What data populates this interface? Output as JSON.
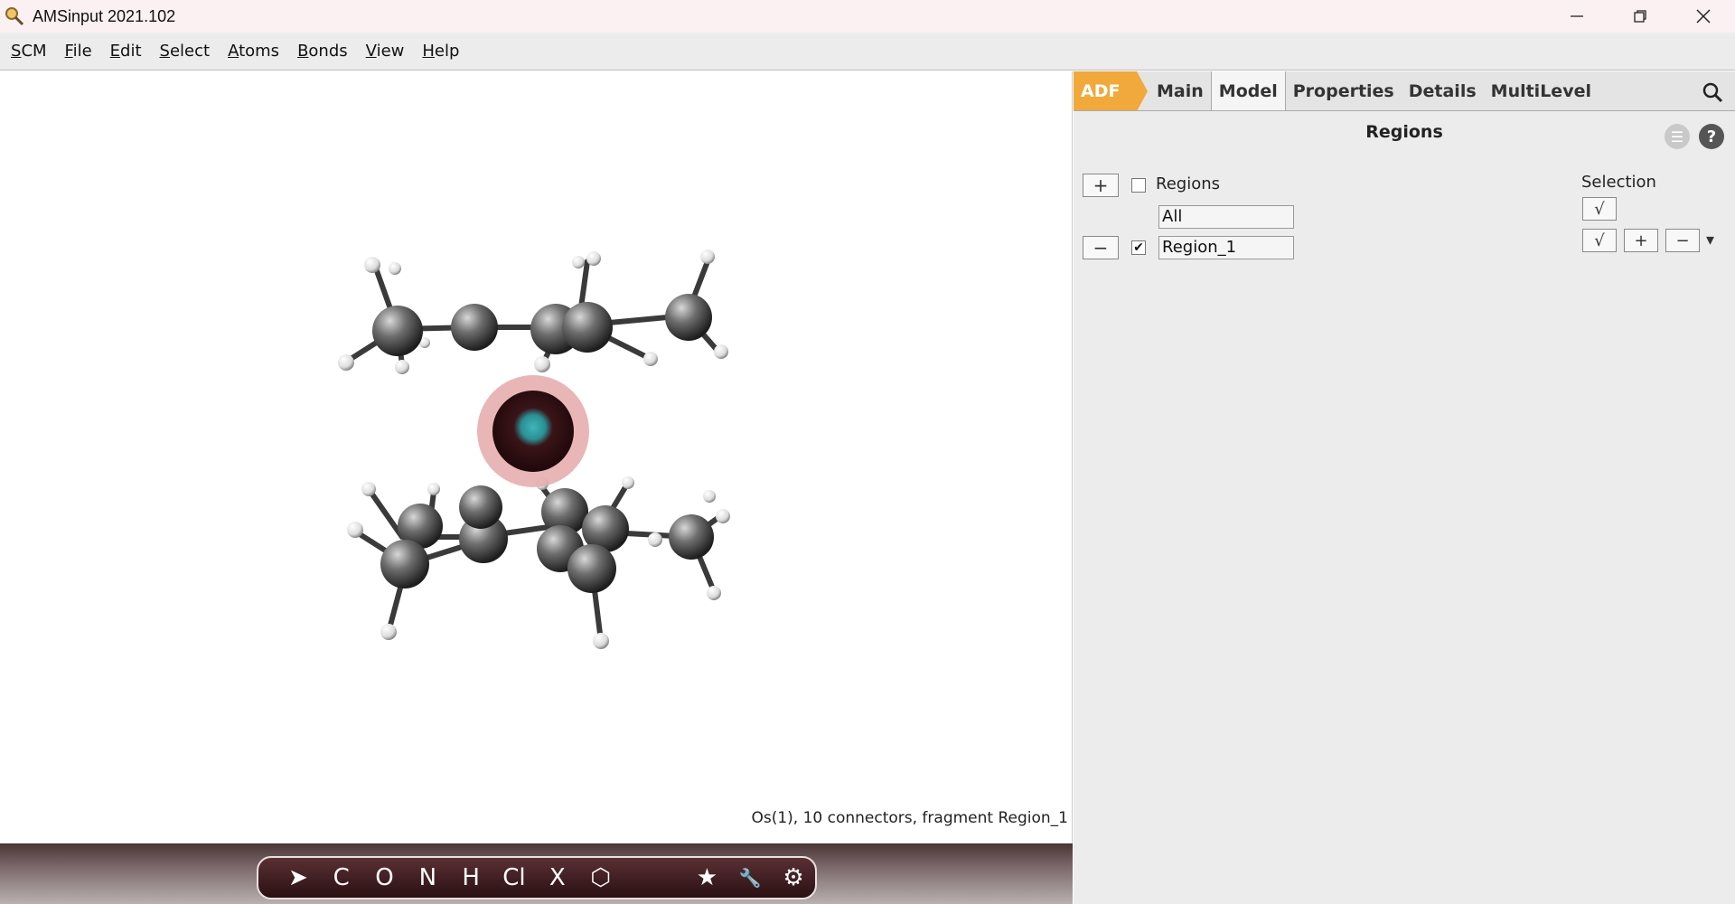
{
  "window": {
    "title": "AMSinput 2021.102",
    "icon": "magnifier-app-icon",
    "controls": [
      "minimize",
      "restore",
      "close"
    ]
  },
  "menubar": {
    "items": [
      {
        "mnemonic": "S",
        "rest": "CM"
      },
      {
        "mnemonic": "F",
        "rest": "ile"
      },
      {
        "mnemonic": "E",
        "rest": "dit"
      },
      {
        "mnemonic": "S",
        "rest": "elect"
      },
      {
        "mnemonic": "A",
        "rest": "toms"
      },
      {
        "mnemonic": "B",
        "rest": "onds"
      },
      {
        "mnemonic": "V",
        "rest": "iew"
      },
      {
        "mnemonic": "H",
        "rest": "elp"
      }
    ]
  },
  "viewport": {
    "status": "Os(1), 10 connectors, fragment Region_1"
  },
  "toolbar": {
    "tools": {
      "pointer": "➤",
      "carbon": "C",
      "oxygen": "O",
      "nitrogen": "N",
      "hydrogen": "H",
      "chlorine": "Cl",
      "other": "X",
      "ring": "⬡",
      "star": "★",
      "wrench": "🔧",
      "gear": "⚙"
    }
  },
  "panel": {
    "tabs": {
      "engine": "ADF",
      "main": "Main",
      "model": "Model",
      "properties": "Properties",
      "details": "Details",
      "multilevel": "MultiLevel"
    },
    "active_tab": "Model",
    "title": "Regions",
    "regions_label": "Regions",
    "add_label": "+",
    "remove_label": "−",
    "all_field": "All",
    "region_field": "Region_1",
    "region_checked": "✔",
    "selection_label": "Selection",
    "check_label": "√",
    "sel_add": "+",
    "sel_remove": "−",
    "dropdown": "▾",
    "help": "?",
    "menu": "☰"
  }
}
